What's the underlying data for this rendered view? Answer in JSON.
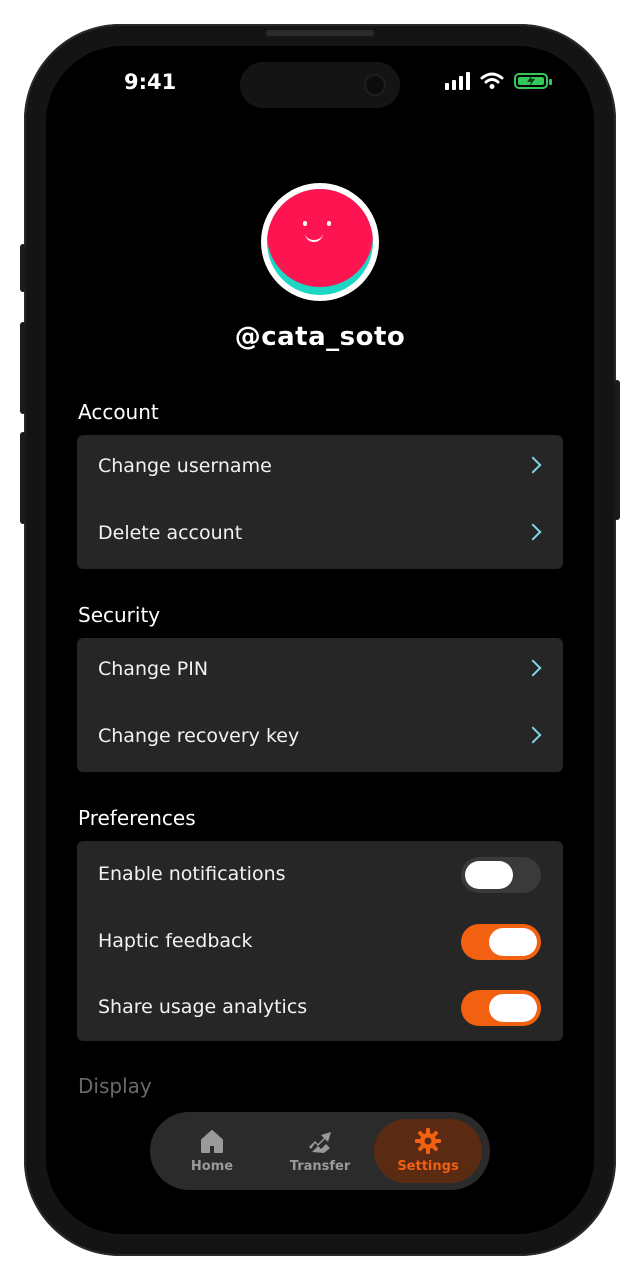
{
  "status_bar": {
    "time": "9:41"
  },
  "profile": {
    "username": "@cata_soto"
  },
  "sections": {
    "account": {
      "title": "Account",
      "items": [
        {
          "label": "Change username"
        },
        {
          "label": "Delete account"
        }
      ]
    },
    "security": {
      "title": "Security",
      "items": [
        {
          "label": "Change PIN"
        },
        {
          "label": "Change recovery key"
        }
      ]
    },
    "preferences": {
      "title": "Preferences",
      "items": [
        {
          "label": "Enable notifications",
          "enabled": false
        },
        {
          "label": "Haptic feedback",
          "enabled": true
        },
        {
          "label": "Share usage analytics",
          "enabled": true
        }
      ]
    },
    "display": {
      "title": "Display"
    }
  },
  "tabbar": {
    "tabs": [
      {
        "label": "Home",
        "icon": "home-icon",
        "active": false
      },
      {
        "label": "Transfer",
        "icon": "transfer-icon",
        "active": false
      },
      {
        "label": "Settings",
        "icon": "gear-icon",
        "active": true
      }
    ]
  },
  "colors": {
    "accent": "#f26012",
    "chevron": "#7fd6e6",
    "card": "#262626",
    "avatar_face": "#ff1452",
    "avatar_accent": "#1ed6c4"
  }
}
